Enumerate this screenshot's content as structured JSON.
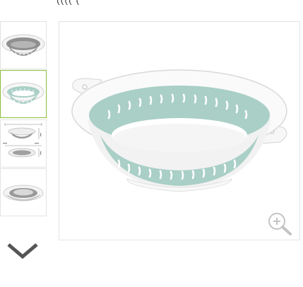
{
  "gallery": {
    "top_fragment": "(((( (",
    "thumbnails": [
      {
        "icon": "colander-gray-icon",
        "selected": false
      },
      {
        "icon": "colander-teal-icon",
        "selected": true
      },
      {
        "icon": "colander-dimensions-icon",
        "selected": false
      },
      {
        "icon": "colander-collapsed-icon",
        "selected": false
      }
    ],
    "scroll_icon": "chevron-down-icon",
    "zoom_icon": "zoom-in-icon",
    "colors": {
      "selected_border": "#8bbd3a",
      "frame_border": "#e3e3e3",
      "teal": "#a9cfc6",
      "gray": "#9a9a9a"
    }
  }
}
